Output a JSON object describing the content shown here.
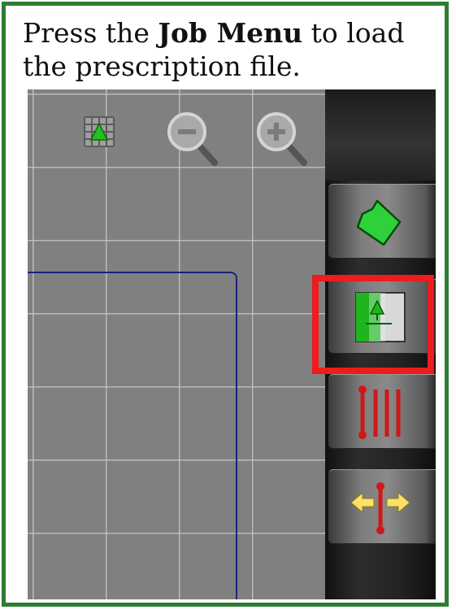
{
  "instruction": {
    "prefix": "Press the ",
    "emphasis": "Job Menu",
    "suffix": " to load the prescription file."
  },
  "map_toolbar": {
    "icons": [
      "grid-map-icon",
      "zoom-out-icon",
      "zoom-in-icon"
    ]
  },
  "side_rail": {
    "buttons": [
      {
        "icon": "field-boundary-icon"
      },
      {
        "icon": "job-menu-icon",
        "highlighted": true
      },
      {
        "icon": "guidance-lines-icon"
      },
      {
        "icon": "nudge-shift-icon"
      }
    ]
  },
  "colors": {
    "frame_border": "#2e7d32",
    "highlight": "#ee1c1c",
    "accent_green": "#22c022",
    "boundary_line": "#1a237e",
    "guidance_red": "#d01818",
    "arrow_yellow": "#ffe066"
  }
}
